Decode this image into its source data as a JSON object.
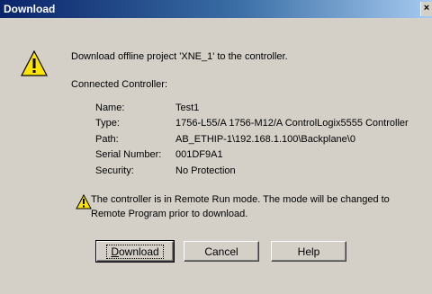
{
  "window": {
    "title": "Download",
    "close_glyph": "×"
  },
  "message": {
    "main": "Download offline project 'XNE_1' to the controller.",
    "connected_heading": "Connected Controller:"
  },
  "controller": {
    "rows": [
      {
        "label": "Name:",
        "value": "Test1"
      },
      {
        "label": "Type:",
        "value": "1756-L55/A 1756-M12/A ControlLogix5555 Controller"
      },
      {
        "label": "Path:",
        "value": "AB_ETHIP-1\\192.168.1.100\\Backplane\\0"
      },
      {
        "label": "Serial Number:",
        "value": "001DF9A1"
      },
      {
        "label": "Security:",
        "value": "No Protection"
      }
    ]
  },
  "warning": {
    "line1": "The controller is in Remote Run mode. The mode will be changed to",
    "line2": "Remote Program prior to download."
  },
  "buttons": {
    "download_prefix": "D",
    "download_rest": "ownload",
    "cancel": "Cancel",
    "help": "Help"
  },
  "icons": {
    "big": "warning-icon",
    "small": "warning-icon"
  },
  "colors": {
    "title_start": "#0a246a",
    "title_end": "#a6caf0",
    "face": "#d4d0c8",
    "warning_yellow": "#ffe400"
  }
}
